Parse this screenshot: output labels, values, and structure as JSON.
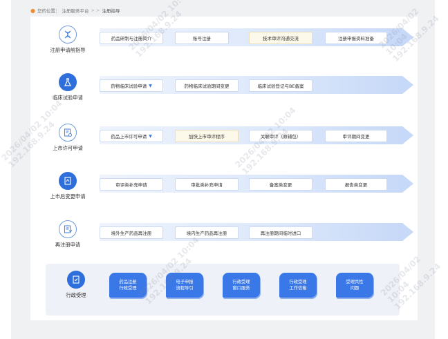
{
  "breadcrumb": {
    "prefix": "您的位置：",
    "home": "注册服务平台",
    "sep": "> >",
    "current": "注册指导"
  },
  "rows": [
    {
      "label": "注册申请前指导",
      "icon": "dna-icon",
      "items": [
        "药品研制与注册简介",
        "账号注册",
        "技术审评沟通交流",
        "注册申报资料准备"
      ]
    },
    {
      "label": "临床试验申请",
      "icon": "flask-icon",
      "items": [
        "药物临床试验申请",
        "药物临床试验期间变更",
        "临床试验登记与BE备案"
      ]
    },
    {
      "label": "上市许可申请",
      "icon": "license-icon",
      "items": [
        "药品上市许可申请",
        "加快上市审评程序",
        "关联审评（原辅包）",
        "审评期间变更"
      ]
    },
    {
      "label": "上市后变更申请",
      "icon": "change-doc-icon",
      "items": [
        "审评类补充申请",
        "审批类补充申请",
        "备案类变更",
        "报告类变更"
      ]
    },
    {
      "label": "再注册申请",
      "icon": "renew-doc-icon",
      "items": [
        "境外生产药品再注册",
        "境内生产药品再注册",
        "再注册期间临时进口"
      ]
    }
  ],
  "admin": {
    "label": "行政受理",
    "icon": "checklist-icon",
    "tiles": [
      "药品注册\n行政受理",
      "电子申报\n流程导引",
      "行政受理\n窗口服务",
      "行政受理\n工作信箱",
      "受理共性\n问题"
    ]
  },
  "watermark": "2026/04/02 10:04\n192.168.9.24",
  "colors": {
    "accent": "#2f6fdc",
    "tile": "#3b78e7",
    "highlight": "#fdf9ea"
  }
}
